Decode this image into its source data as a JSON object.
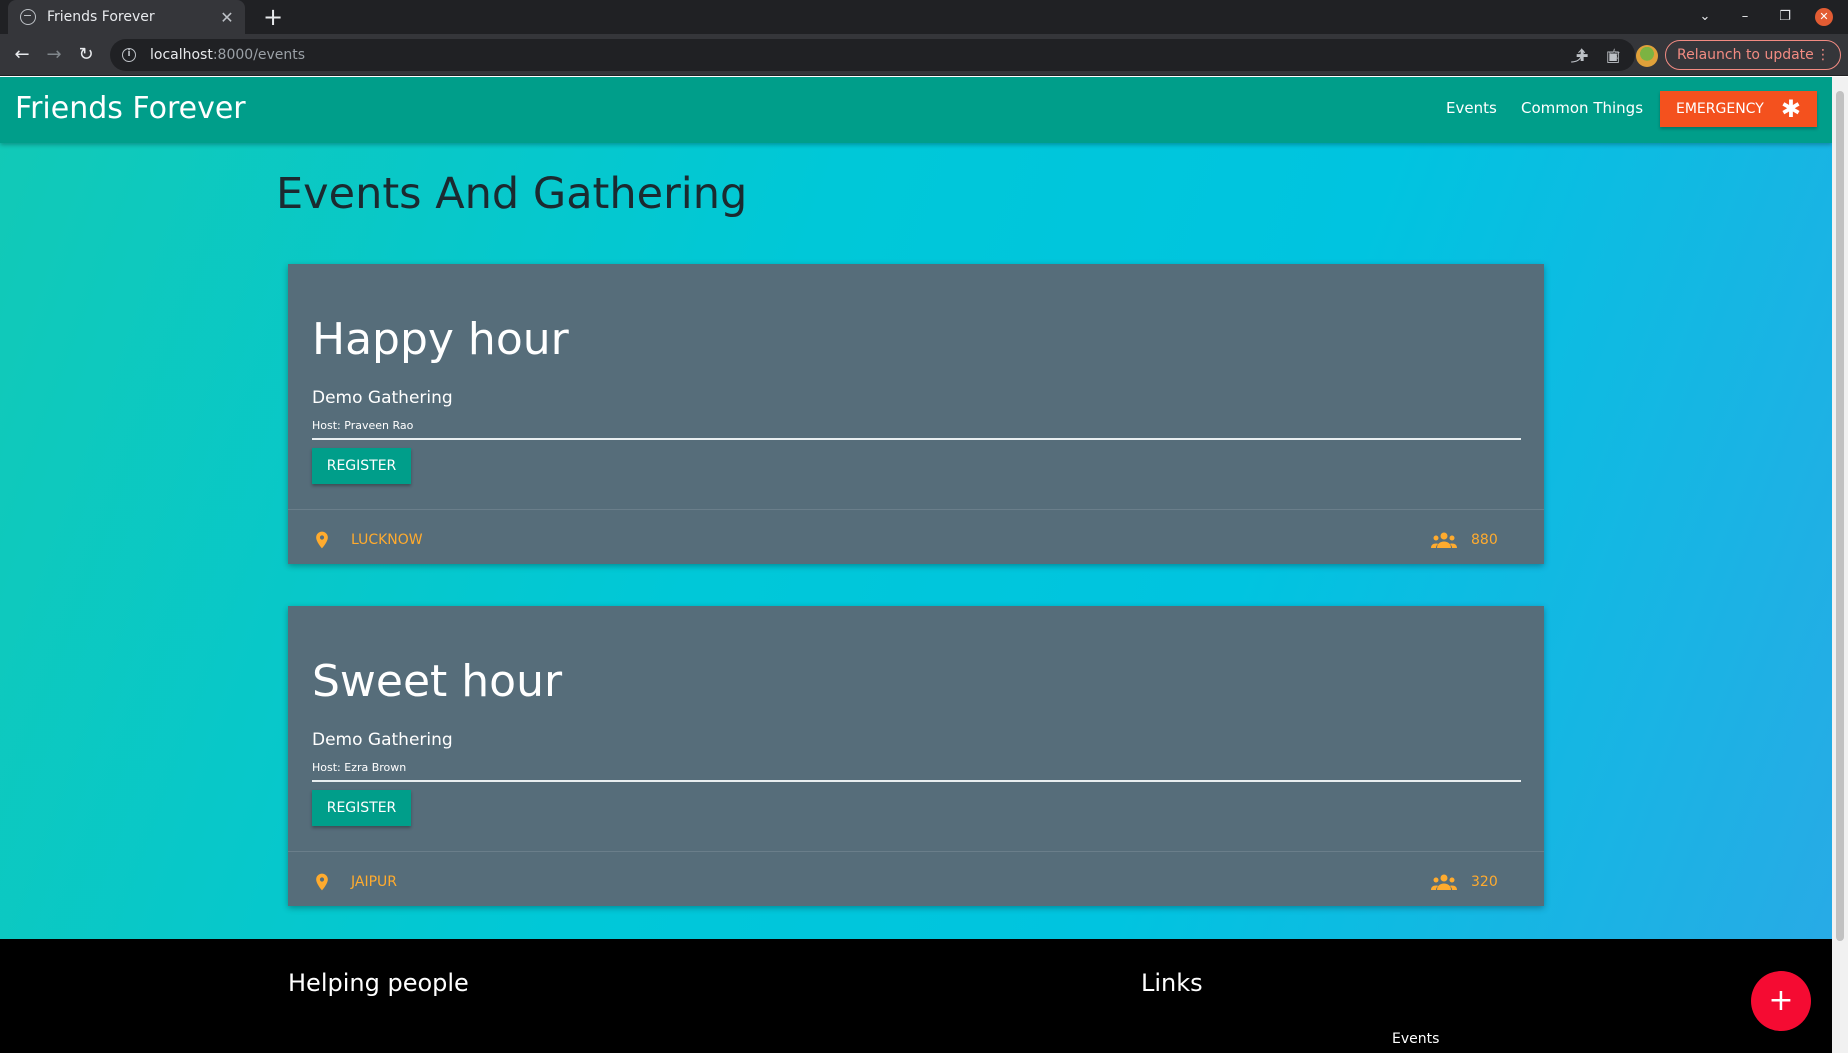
{
  "browser": {
    "tab_title": "Friends Forever",
    "tab_close": "✕",
    "new_tab": "+",
    "url_host": "localhost",
    "url_rest": ":8000/events",
    "relaunch_label": "Relaunch to update",
    "relaunch_menu": "⋮"
  },
  "navbar": {
    "brand": "Friends Forever",
    "links": [
      "Events",
      "Common Things"
    ],
    "emergency_label": "EMERGENCY",
    "emergency_icon": "✱"
  },
  "page": {
    "title": "Events And Gathering"
  },
  "events": [
    {
      "title": "Happy hour",
      "subtitle": "Demo Gathering",
      "host": "Host: Praveen Rao",
      "register_label": "REGISTER",
      "location": "LUCKNOW",
      "attendees": "880"
    },
    {
      "title": "Sweet hour",
      "subtitle": "Demo Gathering",
      "host": "Host: Ezra Brown",
      "register_label": "REGISTER",
      "location": "JAIPUR",
      "attendees": "320"
    }
  ],
  "footer": {
    "left_heading": "Helping people",
    "right_heading": "Links",
    "links": [
      "Events"
    ]
  },
  "fab": {
    "label": "+"
  },
  "colors": {
    "appbar": "#009e8a",
    "emergency": "#f4511e",
    "card": "#566d7a",
    "accent_orange": "#ffab2e",
    "fab": "#f50b32"
  }
}
